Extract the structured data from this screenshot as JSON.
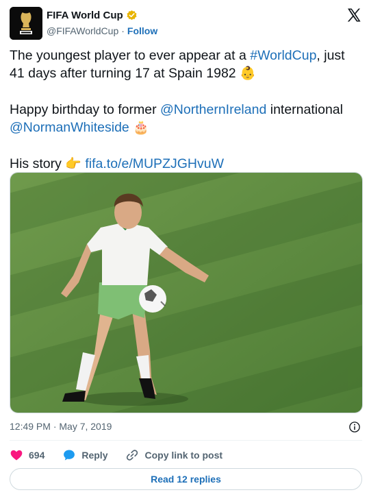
{
  "author": {
    "display_name": "FIFA World Cup",
    "handle": "@FIFAWorldCup",
    "separator": "·",
    "follow_label": "Follow",
    "verified_color": "#e8b400"
  },
  "tweet": {
    "line1_pre": "The youngest player to ever appear at a ",
    "line1_hashtag": "#WorldCup",
    "line1_post": ", just 41 days after turning 17 at Spain 1982 ",
    "line2_pre": "Happy birthday to former ",
    "line2_mention1": "@NorthernIreland",
    "line2_mid": " international ",
    "line2_mention2": "@NormanWhiteside",
    "line3_pre": "His story ",
    "line3_link": "fifa.to/e/MUPZJGHvuW",
    "emoji_baby": "👶",
    "emoji_cake": "🎂",
    "emoji_point": "👉"
  },
  "meta": {
    "timestamp": "12:49 PM · May 7, 2019"
  },
  "actions": {
    "like_count": "694",
    "reply_label": "Reply",
    "copy_label": "Copy link to post"
  },
  "replies_button": {
    "label": "Read 12 replies"
  },
  "colors": {
    "link": "#1d6fb8",
    "like": "#f91880",
    "reply": "#1d9bf0",
    "pitch": "#5d8a3f"
  },
  "icons": [
    "fifa-world-cup-logo",
    "verified-badge-icon",
    "x-logo-icon",
    "info-icon",
    "heart-icon",
    "reply-bubble-icon",
    "link-icon"
  ]
}
